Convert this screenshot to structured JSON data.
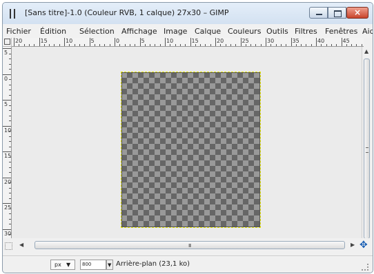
{
  "window": {
    "title": "[Sans titre]-1.0 (Couleur RVB, 1 calque) 27x30 – GIMP",
    "controls": {
      "minimize": "minimize",
      "maximize": "maximize",
      "close": "×"
    }
  },
  "menu": {
    "items": [
      "Fichier",
      "Édition",
      "Sélection",
      "Affichage",
      "Image",
      "Calque",
      "Couleurs",
      "Outils",
      "Filtres",
      "Fenêtres",
      "Aid"
    ]
  },
  "rulers": {
    "horizontal_labels": [
      "20",
      "15",
      "10",
      "5",
      "0",
      "5",
      "10",
      "15",
      "20",
      "25",
      "30",
      "35",
      "40",
      "45"
    ],
    "vertical_labels": [
      "5",
      "0",
      "5",
      "10",
      "15",
      "20",
      "25",
      "30"
    ]
  },
  "scrollbar": {
    "horizontal_grip": "III"
  },
  "status": {
    "unit": "px",
    "zoom": "800",
    "message": "Arrière-plan (23,1 ko)"
  },
  "colors": {
    "checker_dark": "#666666",
    "checker_light": "#999999",
    "selection_border": "#e6e600",
    "titlebar": "#dfe9f5",
    "close_button": "#c8442c"
  },
  "icons": {
    "app": "gimp-window-icon",
    "navigate": "navigate-cross-icon",
    "quick_mask": "quick-mask-icon"
  }
}
